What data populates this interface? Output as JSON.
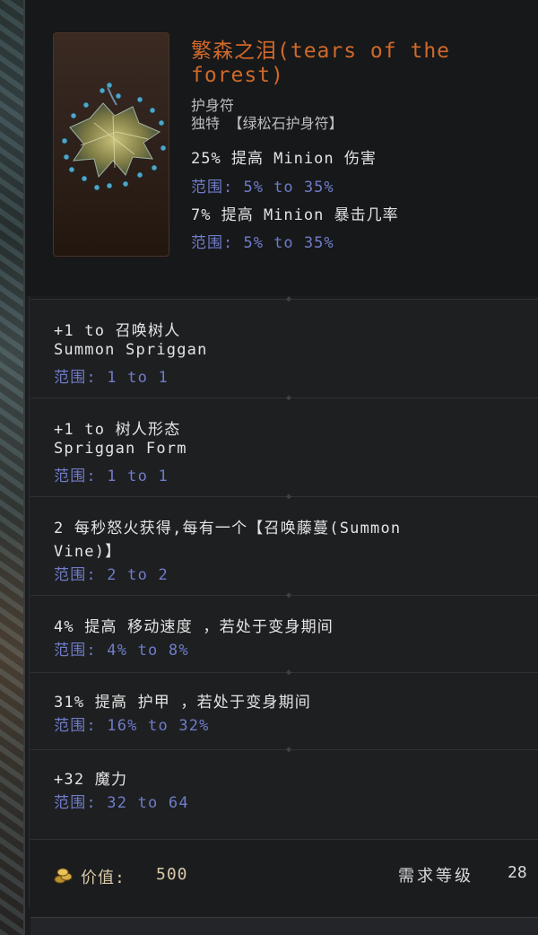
{
  "item": {
    "title": "繁森之泪(tears of the forest)",
    "base_type": "护身符",
    "rarity": "独特 【绿松石护身符】",
    "icon": "tears-of-the-forest-amulet-icon"
  },
  "implicits": [
    {
      "text": "25% 提高 Minion 伤害",
      "range": "范围: 5% to 35%"
    },
    {
      "text": "7% 提高 Minion 暴击几率",
      "range": "范围: 5% to 35%"
    }
  ],
  "affixes": [
    {
      "line1": "+1 to 召唤树人",
      "line2": "Summon Spriggan",
      "range": "范围: 1 to 1"
    },
    {
      "line1": "+1 to 树人形态",
      "line2": "Spriggan Form",
      "range": "范围: 1 to 1"
    },
    {
      "line1": "2 每秒怒火获得,每有一个【召唤藤蔓(Summon",
      "line2": "Vine)】",
      "range": "范围: 2 to 2"
    },
    {
      "line1": "4% 提高 移动速度 ，若处于变身期间",
      "range": "范围: 4% to 8%"
    },
    {
      "line1": "31% 提高 护甲 ，若处于变身期间",
      "range": "范围: 16% to 32%"
    },
    {
      "line1": "+32 魔力",
      "range": "范围: 32 to 64"
    }
  ],
  "footer": {
    "value_label": "价值:",
    "value": "500",
    "level_label": "需求等级",
    "level": "28",
    "coin_icon": "gold-coins-icon"
  },
  "colors": {
    "title": "#d0692a",
    "range": "#6f7cc9",
    "text": "#e2e2e2",
    "gold": "#d8c9a6"
  }
}
